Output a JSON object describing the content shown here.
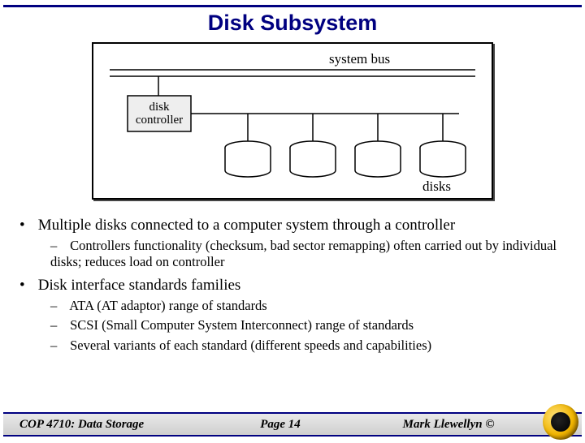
{
  "title": "Disk Subsystem",
  "diagram": {
    "bus_label": "system bus",
    "controller_label_l1": "disk",
    "controller_label_l2": "controller",
    "disks_label": "disks"
  },
  "bullets": {
    "b1": "Multiple disks connected to a computer system through a controller",
    "b1a": "Controllers functionality (checksum, bad sector remapping) often carried out by individual disks; reduces load on controller",
    "b2": "Disk interface standards families",
    "b2a": "ATA (AT adaptor) range of standards",
    "b2b": "SCSI (Small Computer System Interconnect) range of standards",
    "b2c": "Several variants of each standard (different speeds and capabilities)"
  },
  "footer": {
    "left": "COP 4710: Data Storage",
    "mid": "Page 14",
    "right": "Mark Llewellyn ©"
  }
}
